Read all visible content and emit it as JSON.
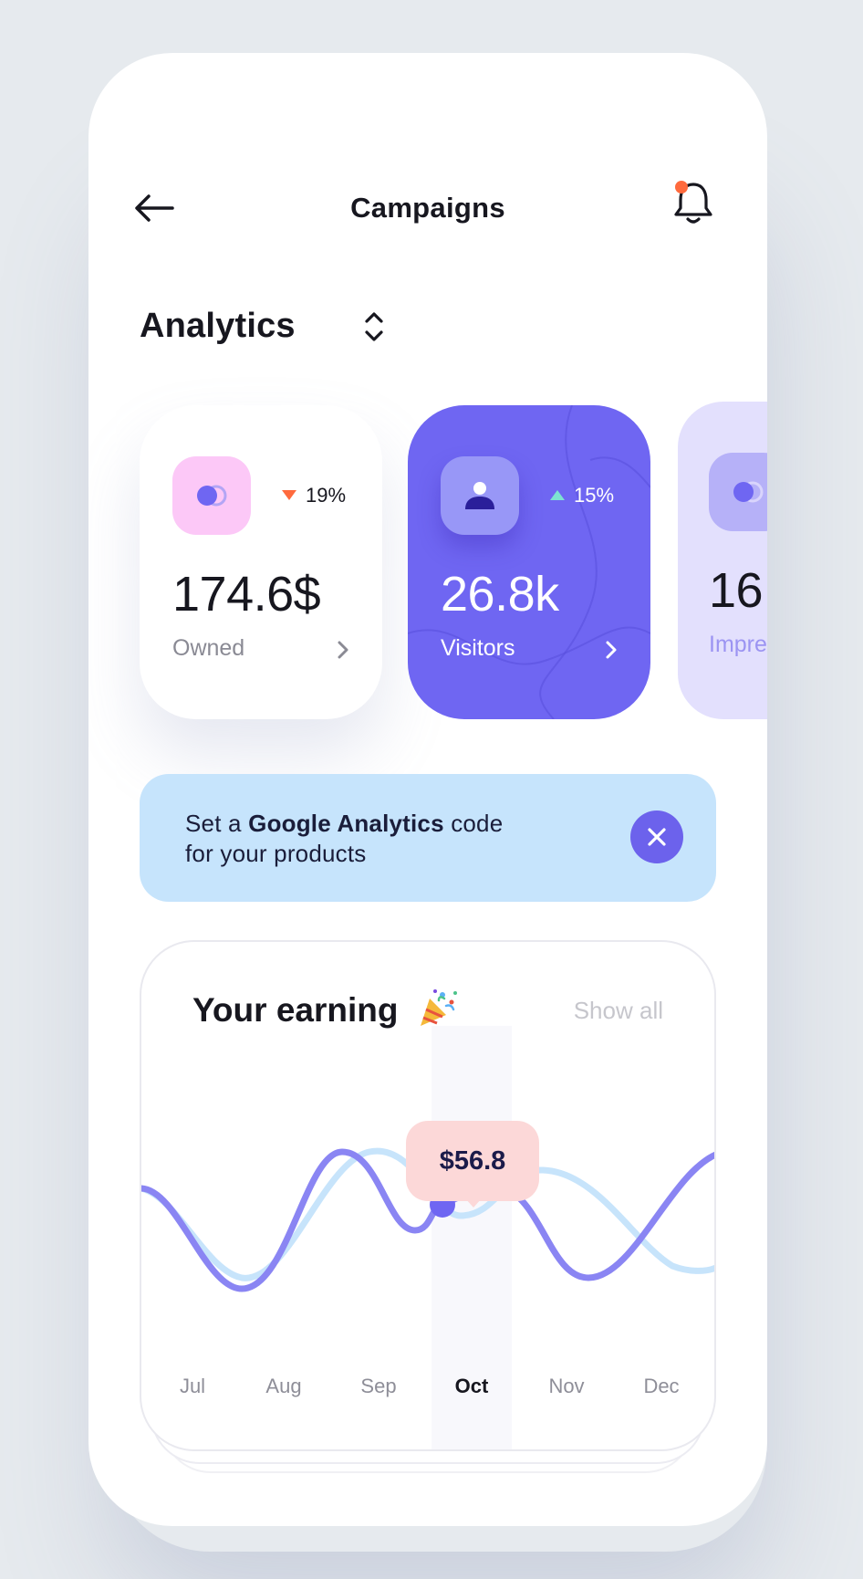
{
  "header": {
    "title": "Campaigns"
  },
  "section": {
    "title": "Analytics"
  },
  "cards": [
    {
      "value": "174.6$",
      "label": "Owned",
      "trend": "19%",
      "trend_direction": "down",
      "trend_color": "#ff6a3d",
      "icon": "toggle-icon"
    },
    {
      "value": "26.8k",
      "label": "Visitors",
      "trend": "15%",
      "trend_direction": "up",
      "trend_color": "#7de3d1",
      "icon": "user-icon"
    },
    {
      "value": "16.",
      "label": "Impre",
      "icon": "toggle-icon"
    }
  ],
  "banner": {
    "text_prefix": "Set a ",
    "text_bold": "Google Analytics",
    "text_suffix": " code",
    "text_line2": "for your products"
  },
  "earning": {
    "title": "Your earning",
    "emoji_icon": "party-popper-icon",
    "show_all_label": "Show all",
    "tooltip_value": "$56.8",
    "months": [
      "Jul",
      "Aug",
      "Sep",
      "Oct",
      "Nov",
      "Dec"
    ],
    "active_month": "Oct"
  },
  "colors": {
    "accent": "#6f66f2",
    "series_primary": "#8a85f3",
    "series_secondary": "#c7e4fb",
    "notification_dot": "#ff6a3d"
  }
}
